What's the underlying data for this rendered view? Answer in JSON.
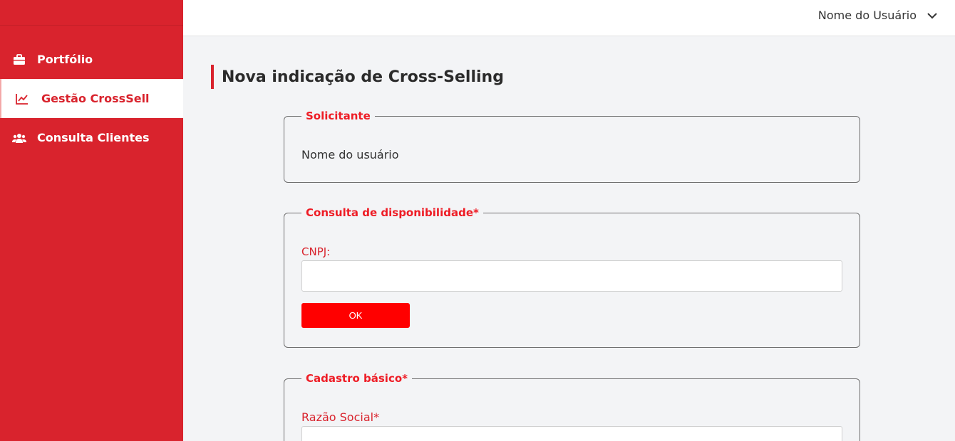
{
  "sidebar": {
    "items": [
      {
        "label": "Portfólio",
        "icon": "briefcase-icon",
        "active": false
      },
      {
        "label": "Gestão CrossSell",
        "icon": "line-chart-icon",
        "active": true
      },
      {
        "label": "Consulta Clientes",
        "icon": "users-icon",
        "active": false
      }
    ]
  },
  "header": {
    "user_name": "Nome do Usuário",
    "menu_icon": "chevron-down-icon"
  },
  "main": {
    "title": "Nova indicação de Cross-Selling",
    "solicitante": {
      "legend": "Solicitante",
      "value": "Nome do usuário"
    },
    "disponibilidade": {
      "legend": "Consulta de disponibilidade*",
      "cnpj_label": "CNPJ:",
      "cnpj_value": "",
      "ok_label": "OK"
    },
    "cadastro": {
      "legend": "Cadastro básico*",
      "razao_label": "Razão Social*",
      "razao_value": ""
    }
  },
  "colors": {
    "brand": "#d9232d",
    "accent": "#ff0000",
    "legend": "#ee1c25"
  }
}
